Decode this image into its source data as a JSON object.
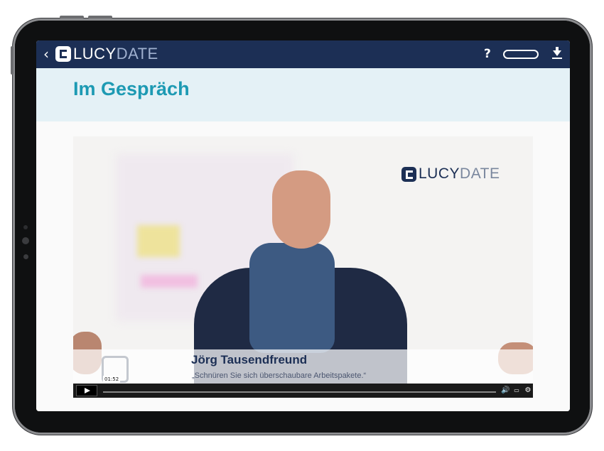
{
  "app": {
    "logo_primary": "LUCY",
    "logo_secondary": "DATE",
    "help_label": "?"
  },
  "progress": {
    "fraction": 0.0
  },
  "page": {
    "title": "Im Gespräch"
  },
  "video": {
    "brand_primary": "LUCY",
    "brand_secondary": "DATE",
    "speaker_name": "Jörg Tausendfreund",
    "quote": "„Schnüren Sie sich überschaubare Arbeitspakete.“",
    "timestamp": "01:52",
    "progress_fraction": 0.0
  },
  "icons": {
    "back": "chevron-left-icon",
    "download": "download-icon",
    "play": "play-icon",
    "volume": "volume-icon",
    "captions": "captions-icon",
    "settings": "settings-icon",
    "transcript": "transcript-icon",
    "fullscreen": "fullscreen-icon"
  },
  "colors": {
    "topbar": "#1c2f55",
    "accent": "#1d9ab3",
    "title_band": "#e4f1f6"
  }
}
